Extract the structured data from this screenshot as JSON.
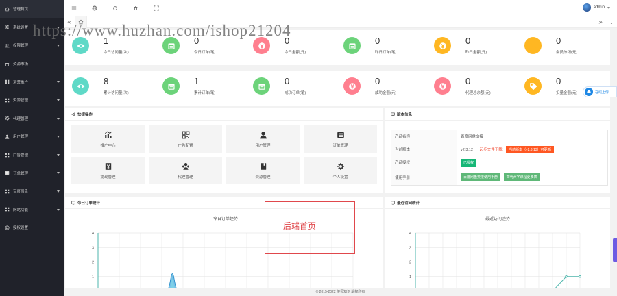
{
  "sidebar": {
    "items": [
      {
        "label": "管理首页",
        "icon": "home-icon",
        "active": true,
        "caret": false
      },
      {
        "label": "系统设置",
        "icon": "gear-icon",
        "caret": true
      },
      {
        "label": "权限管理",
        "icon": "users-icon",
        "caret": true
      },
      {
        "label": "资源市场",
        "icon": "store-icon",
        "caret": false
      },
      {
        "label": "运营推广",
        "icon": "grid-icon",
        "caret": true
      },
      {
        "label": "资源管理",
        "icon": "grid-icon",
        "caret": true
      },
      {
        "label": "代理管理",
        "icon": "gear-icon",
        "caret": true
      },
      {
        "label": "用户管理",
        "icon": "user-icon",
        "caret": true
      },
      {
        "label": "广告管理",
        "icon": "grid-icon",
        "caret": true
      },
      {
        "label": "订单管理",
        "icon": "list-icon",
        "caret": true
      },
      {
        "label": "百度网盘",
        "icon": "grid-icon",
        "caret": true
      },
      {
        "label": "网站功能",
        "icon": "grid-icon",
        "caret": true
      },
      {
        "label": "授权设置",
        "icon": "copyright-icon",
        "caret": false
      }
    ]
  },
  "topbar": {
    "username": "admin"
  },
  "watermark": "https://www.huzhan.com/ishop21204",
  "stats_row1": [
    {
      "value": "1",
      "label": "今日访问量(次)",
      "color": "#5fd9c7",
      "icon": "eye-icon"
    },
    {
      "value": "0",
      "label": "今日订单(笔)",
      "color": "#6cd37a",
      "icon": "calendar-icon"
    },
    {
      "value": "0",
      "label": "今日金额(元)",
      "color": "#ff7f8f",
      "icon": "yen-icon"
    },
    {
      "value": "0",
      "label": "昨日订单(笔)",
      "color": "#6cd37a",
      "icon": "calendar-icon"
    },
    {
      "value": "0",
      "label": "昨日金额(元)",
      "color": "#ffb722",
      "icon": "yen-icon"
    },
    {
      "value": "0",
      "label": "会员分销(元)",
      "color": "#ffb722",
      "icon": "user-icon"
    }
  ],
  "stats_row2": [
    {
      "value": "8",
      "label": "累计访问量(次)",
      "color": "#5fd9c7",
      "icon": "eye-icon"
    },
    {
      "value": "1",
      "label": "累计订单(笔)",
      "color": "#6cd37a",
      "icon": "calendar-icon"
    },
    {
      "value": "0",
      "label": "成功订单(笔)",
      "color": "#6cd37a",
      "icon": "calendar-icon"
    },
    {
      "value": "0",
      "label": "成功金额(元)",
      "color": "#ff7f8f",
      "icon": "yen-icon"
    },
    {
      "value": "0",
      "label": "代理总余额(元)",
      "color": "#ff7f8f",
      "icon": "yen-icon"
    },
    {
      "value": "0",
      "label": "扣量金额(元)",
      "color": "#ffb722",
      "icon": "tag-icon"
    }
  ],
  "quick": {
    "title": "快捷操作",
    "buttons": [
      {
        "label": "推广中心",
        "icon": "chart-icon"
      },
      {
        "label": "广告配置",
        "icon": "qrcode-icon"
      },
      {
        "label": "用户管理",
        "icon": "user-icon"
      },
      {
        "label": "订单管理",
        "icon": "list-icon"
      },
      {
        "label": "提现管理",
        "icon": "yen-box-icon"
      },
      {
        "label": "代理管理",
        "icon": "agents-icon"
      },
      {
        "label": "资源管理",
        "icon": "book-icon"
      },
      {
        "label": "个人设置",
        "icon": "gear-icon"
      }
    ]
  },
  "version": {
    "title": "版本信息",
    "rows": [
      {
        "key": "产品名称",
        "value": "百度网盘交接"
      },
      {
        "key": "当前版本",
        "value": "v2.3.12",
        "link": "起步文件下载",
        "tag": "当前版本（v2.3.13）可更新"
      },
      {
        "key": "产品授权",
        "tag": "已授权"
      },
      {
        "key": "使用手册",
        "tag1": "百度网盘交接使用手册",
        "tag2": "简明大字课程更多表"
      }
    ]
  },
  "orders_card": {
    "title": "今日订单统计",
    "chart_title": "今日订单趋势"
  },
  "visits_card": {
    "title": "最近访问统计",
    "chart_title": "最近访问趋势"
  },
  "chart_data": [
    {
      "type": "area",
      "title": "今日订单趋势",
      "ylim": [
        0,
        4
      ],
      "y_ticks": [
        "0",
        "1",
        "2",
        "3",
        "4"
      ],
      "grid": true,
      "series": [
        {
          "peak_index": 3,
          "values": [
            0,
            0,
            0,
            0,
            1.2,
            0,
            0,
            0,
            0,
            0,
            0,
            0,
            0
          ]
        }
      ]
    },
    {
      "type": "line",
      "title": "最近访问趋势",
      "ylim": [
        0,
        4
      ],
      "y_ticks": [
        "0",
        "1",
        "2",
        "3",
        "4"
      ],
      "grid": true,
      "series": [
        {
          "values": [
            0,
            0,
            0,
            0,
            0,
            0,
            0,
            0,
            0,
            0,
            0,
            1,
            1
          ]
        }
      ]
    }
  ],
  "annotation": {
    "label": "后端首页"
  },
  "float_button": {
    "label": "在线上传"
  },
  "footer": {
    "text": "© 2015-2022 伊贝知识 版权所有"
  }
}
